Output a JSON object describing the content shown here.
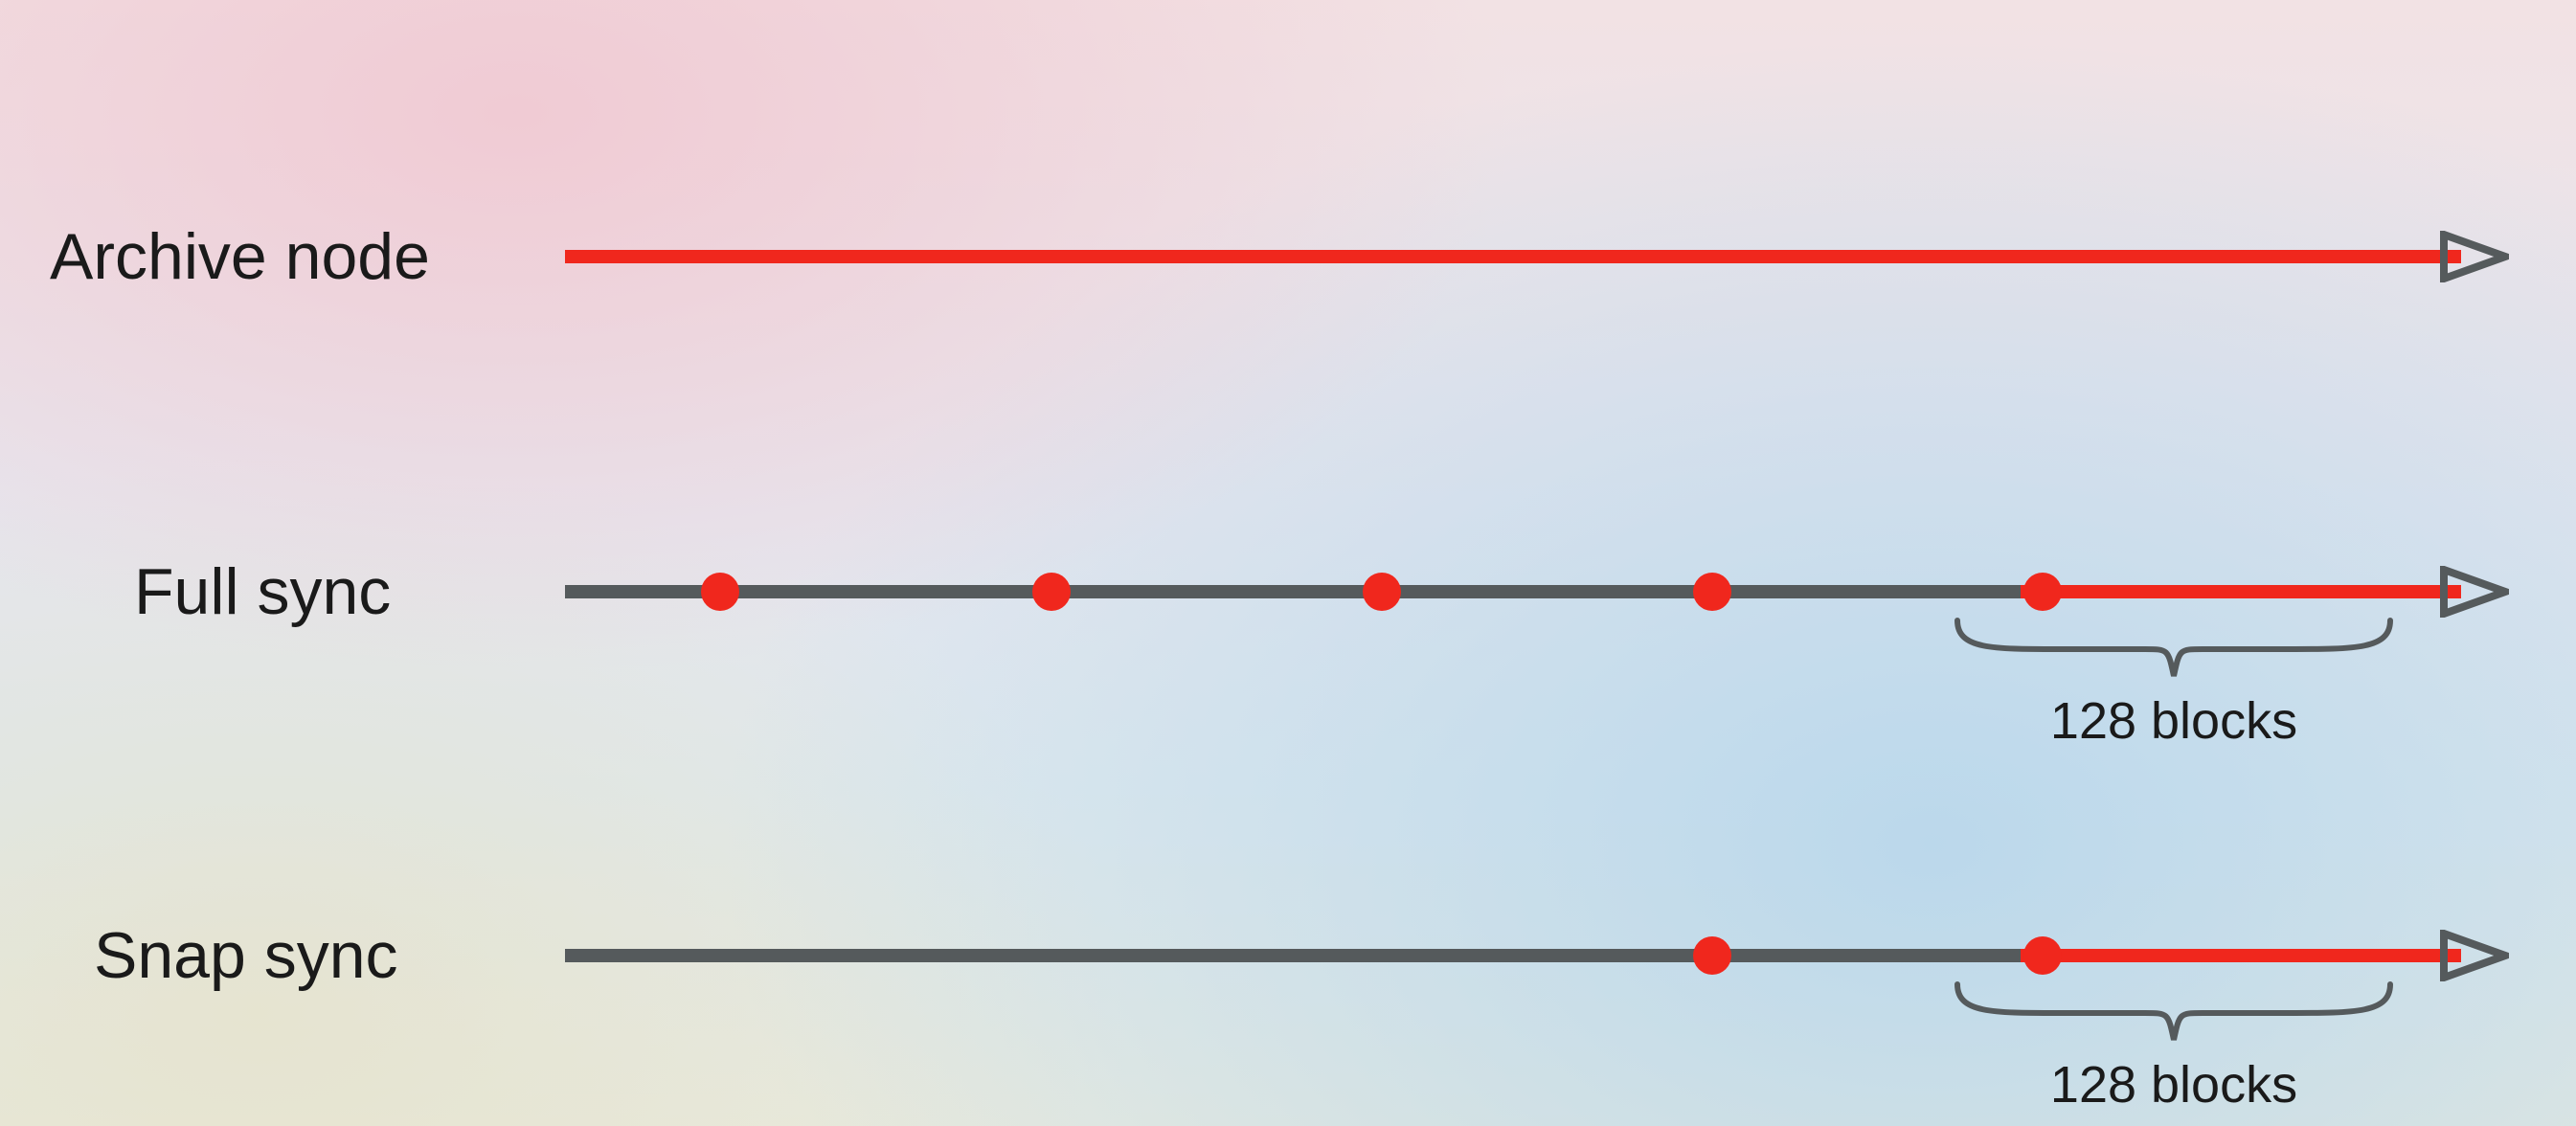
{
  "rows": {
    "archive": {
      "label": "Archive node"
    },
    "full": {
      "label": "Full sync",
      "brace_label": "128 blocks"
    },
    "snap": {
      "label": "Snap sync",
      "brace_label": "128 blocks"
    }
  },
  "colors": {
    "red": "#f0271d",
    "grey": "#555a5c"
  },
  "chart_data": {
    "type": "diagram",
    "title": "",
    "axis": {
      "start": 0,
      "end": 100,
      "units": "timeline-percent"
    },
    "tail_blocks": 128,
    "series": [
      {
        "name": "Archive node",
        "state_retained_pct": [
          0,
          100
        ],
        "checkpoints_pct": [],
        "tail_highlight": false
      },
      {
        "name": "Full sync",
        "state_retained_pct": [
          77,
          100
        ],
        "checkpoints_pct": [
          8,
          25,
          42,
          59,
          76
        ],
        "tail_highlight": true
      },
      {
        "name": "Snap sync",
        "state_retained_pct": [
          77,
          100
        ],
        "checkpoints_pct": [
          59,
          76
        ],
        "tail_highlight": true
      }
    ]
  }
}
